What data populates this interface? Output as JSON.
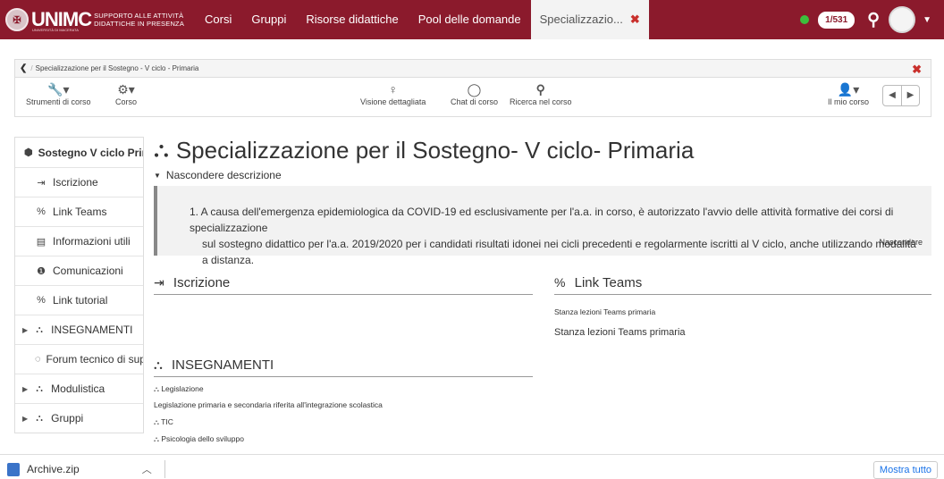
{
  "navbar": {
    "logo_main": "UNIMC",
    "logo_line1": "SUPPORTO ALLE ATTIVITÀ",
    "logo_line2": "DIDATTICHE IN PRESENZA",
    "logo_under": "UNIVERSITÀ DI MACERATA",
    "links": [
      "Corsi",
      "Gruppi",
      "Risorse didattiche",
      "Pool delle domande"
    ],
    "active_tab": "Specializzazio...",
    "counter": "1/531",
    "status_color": "#3cbf3c",
    "brand_color": "#8b1a2c"
  },
  "breadcrumb": {
    "path": [
      "Specializzazione per il Sostegno - V ciclo - Primaria"
    ]
  },
  "toolbar": {
    "left": [
      {
        "label": "Strumenti di corso",
        "icon": "wrench-icon"
      },
      {
        "label": "Corso",
        "icon": "cogs-icon"
      }
    ],
    "center": [
      {
        "label": "Visione dettagliata",
        "icon": "lightbulb-icon"
      },
      {
        "label": "Chat di corso",
        "icon": "chat-icon"
      },
      {
        "label": "Ricerca nel corso",
        "icon": "search-icon"
      }
    ],
    "right": {
      "label": "Il mio corso",
      "icon": "user-icon"
    }
  },
  "sidebar": {
    "items": [
      {
        "label": "Sostegno V ciclo Primaria",
        "icon": "cube-icon"
      },
      {
        "label": "Iscrizione",
        "icon": "sign-in-icon"
      },
      {
        "label": "Link Teams",
        "icon": "link-icon"
      },
      {
        "label": "Informazioni utili",
        "icon": "file-icon"
      },
      {
        "label": "Comunicazioni",
        "icon": "info-icon"
      },
      {
        "label": "Link tutorial",
        "icon": "link-icon"
      },
      {
        "label": "INSEGNAMENTI",
        "icon": "cubes-icon"
      },
      {
        "label": "Forum tecnico di supporto",
        "icon": "forum-icon"
      },
      {
        "label": "Modulistica",
        "icon": "cubes-icon"
      },
      {
        "label": "Gruppi",
        "icon": "cubes-icon"
      }
    ]
  },
  "main": {
    "title": "Specializzazione per il Sostegno- V ciclo- Primaria",
    "desc_toggle": "Nascondere descrizione",
    "desc_line1": "1. A causa dell'emergenza epidemiologica da COVID-19 ed esclusivamente per l'a.a. in corso, è autorizzato l'avvio delle attività formative dei corsi di specializzazione",
    "desc_line2": "sul sostegno didattico per l'a.a. 2019/2020 per i candidati risultati idonei nei cicli precedenti e regolarmente iscritti al V ciclo, anche utilizzando modalità a distanza.",
    "desc_hide": "Nascondere",
    "sections": {
      "iscrizione": "Iscrizione",
      "link_teams": "Link Teams",
      "link_teams_caption": "Stanza lezioni Teams primaria",
      "link_teams_text": "Stanza lezioni Teams primaria",
      "insegnamenti": "INSEGNAMENTI",
      "insegnamenti_items": [
        "Legislazione",
        "Legislazione primaria e secondaria riferita all'integrazione scolastica",
        "TIC",
        "Psicologia dello sviluppo"
      ]
    }
  },
  "downloads": {
    "file": "Archive.zip",
    "show_all": "Mostra tutto"
  }
}
